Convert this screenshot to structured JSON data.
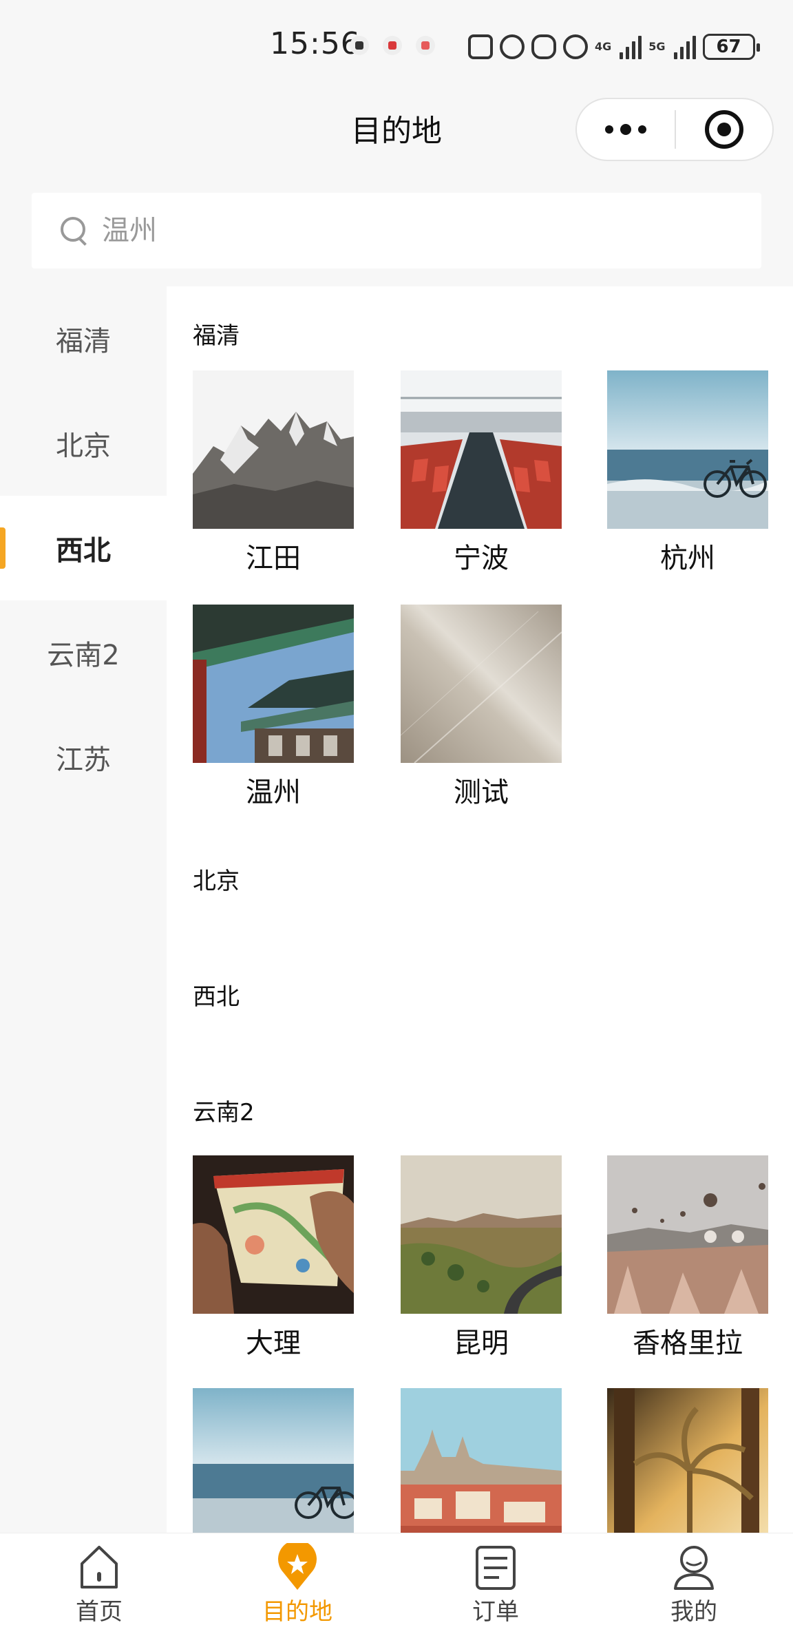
{
  "status": {
    "time": "15:56",
    "network_1": "4G",
    "network_2": "5G",
    "battery": "67"
  },
  "nav": {
    "title": "目的地"
  },
  "search": {
    "placeholder": "温州"
  },
  "sidebar": {
    "items": [
      {
        "label": "福清"
      },
      {
        "label": "北京"
      },
      {
        "label": "西北"
      },
      {
        "label": "云南2"
      },
      {
        "label": "江苏"
      }
    ],
    "active_index": 2
  },
  "sections": [
    {
      "title": "福清",
      "items": [
        {
          "name": "江田",
          "image": "mountain"
        },
        {
          "name": "宁波",
          "image": "train-interior"
        },
        {
          "name": "杭州",
          "image": "beach-bicycle"
        },
        {
          "name": "温州",
          "image": "pagoda-roof"
        },
        {
          "name": "测试",
          "image": "fabric-texture"
        }
      ]
    },
    {
      "title": "北京",
      "items": []
    },
    {
      "title": "西北",
      "items": []
    },
    {
      "title": "云南2",
      "items": [
        {
          "name": "大理",
          "image": "map-hands"
        },
        {
          "name": "昆明",
          "image": "desert-road"
        },
        {
          "name": "香格里拉",
          "image": "hot-air-balloons"
        },
        {
          "name": "",
          "image": "beach-bicycle"
        },
        {
          "name": "",
          "image": "castle-city"
        },
        {
          "name": "",
          "image": "palm-trees"
        }
      ]
    }
  ],
  "tabbar": {
    "tabs": [
      {
        "label": "首页",
        "icon": "home-icon"
      },
      {
        "label": "目的地",
        "icon": "location-pin-icon"
      },
      {
        "label": "订单",
        "icon": "order-list-icon"
      },
      {
        "label": "我的",
        "icon": "profile-icon"
      }
    ],
    "active_index": 1,
    "active_color": "#f39800"
  }
}
